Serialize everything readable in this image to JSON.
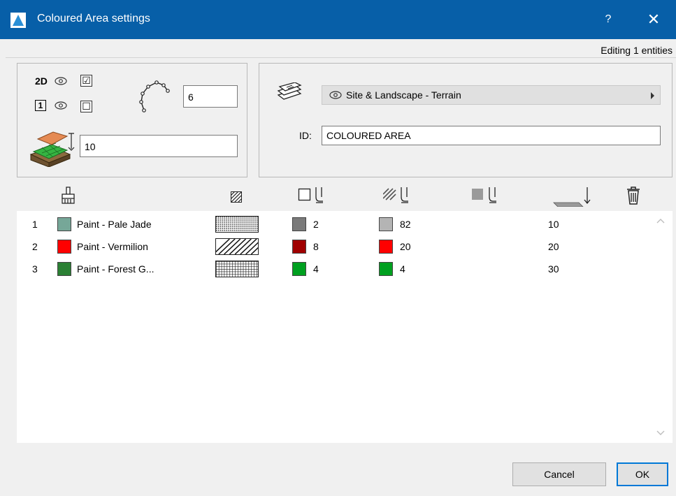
{
  "window": {
    "title": "Coloured Area settings",
    "help": "?",
    "close": "✕"
  },
  "status": {
    "editing": "Editing 1 entities"
  },
  "geometry_panel": {
    "label_2d": "2D",
    "label_3d": "1",
    "check_2d": "☑",
    "check_3d": "☐",
    "segments_value": "6",
    "height_value": "10"
  },
  "layer_panel": {
    "layer_value": "Site & Landscape - Terrain",
    "id_label": "ID:",
    "id_value": "COLOURED AREA"
  },
  "columns": [
    "paint",
    "hatch",
    "contour-pen",
    "fill-pen",
    "background-pen",
    "elevation",
    "delete"
  ],
  "rows": [
    {
      "num": "1",
      "name": "Paint - Pale Jade",
      "color": "#76a798",
      "hatch": "dots",
      "pen1": "2",
      "pen1_color": "#7a7a7a",
      "pen2": "82",
      "pen2_color": "#b4b4b4",
      "elev": "10"
    },
    {
      "num": "2",
      "name": "Paint - Vermilion",
      "color": "#ff0000",
      "hatch": "diagonal",
      "pen1": "8",
      "pen1_color": "#a00000",
      "pen2": "20",
      "pen2_color": "#ff0000",
      "elev": "20"
    },
    {
      "num": "3",
      "name": "Paint - Forest G...",
      "color": "#2b8034",
      "hatch": "grid",
      "pen1": "4",
      "pen1_color": "#00a020",
      "pen2": "4",
      "pen2_color": "#00a020",
      "elev": "30"
    }
  ],
  "buttons": {
    "cancel": "Cancel",
    "ok": "OK"
  }
}
